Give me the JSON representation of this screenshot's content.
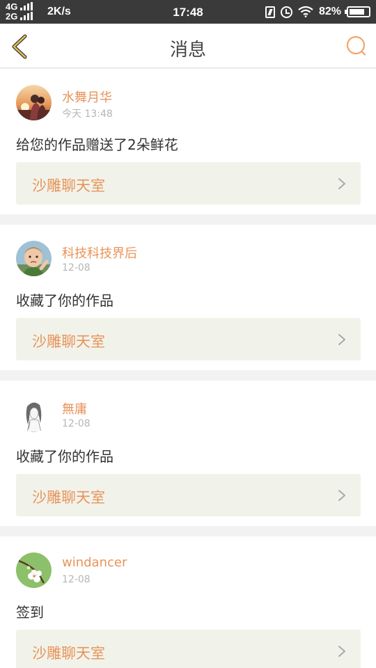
{
  "status_bar": {
    "network_top": "4G",
    "network_bottom": "2G",
    "speed": "2K/s",
    "time": "17:48",
    "battery_percent": "82%",
    "battery_level": 0.82
  },
  "header": {
    "title": "消息",
    "back_icon": "chevron-left-icon",
    "search_icon": "search-icon"
  },
  "colors": {
    "accent": "#e8935a",
    "room_bg": "#f1f3ea",
    "back_icon": "#c9a64a"
  },
  "messages": [
    {
      "user": "水舞月华",
      "time": "今天 13:48",
      "text": "给您的作品赠送了2朵鲜花",
      "room": "沙雕聊天室"
    },
    {
      "user": "科技科技界后",
      "time": "12-08",
      "text": "收藏了你的作品",
      "room": "沙雕聊天室"
    },
    {
      "user": "無庸",
      "time": "12-08",
      "text": "收藏了你的作品",
      "room": "沙雕聊天室"
    },
    {
      "user": "windancer",
      "time": "12-08",
      "text": "签到",
      "room": "沙雕聊天室"
    }
  ]
}
